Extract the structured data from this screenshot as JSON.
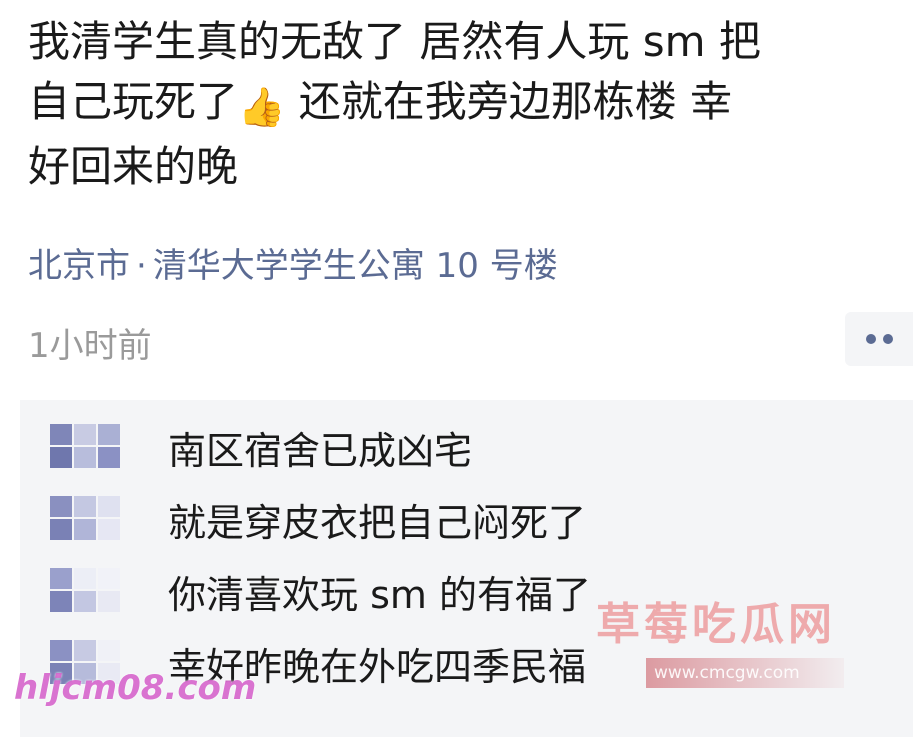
{
  "post": {
    "line1": "我清学生真的无敌了 居然有人玩 sm 把",
    "line2_a": "自己玩死了",
    "line2_emoji": "👍",
    "line2_b": " 还就在我旁边那栋楼 幸",
    "line3": "好回来的晚",
    "location_city": "北京市",
    "location_sep": "·",
    "location_place": "清华大学学生公寓 10 号楼",
    "time": "1小时前"
  },
  "more_icon": "more-dots-icon",
  "comments": [
    {
      "text": "南区宿舍已成凶宅",
      "avatar_colors": [
        "#7f86b8",
        "#c8cbe3",
        "#aab0d4",
        "#6f77ad",
        "#b8bddc",
        "#8b91c4"
      ]
    },
    {
      "text": "就是穿皮衣把自己闷死了",
      "avatar_colors": [
        "#8a90c0",
        "#c4c8e2",
        "#dfe1f0",
        "#7a81b5",
        "#b0b5d8",
        "#e6e7f3"
      ]
    },
    {
      "text": "你清喜欢玩 sm 的有福了",
      "avatar_colors": [
        "#9aa0cc",
        "#eceef6",
        "#f1f2f8",
        "#7d84b8",
        "#c3c7e2",
        "#e8e9f3"
      ]
    },
    {
      "text": "幸好昨晚在外吃四季民福",
      "avatar_colors": [
        "#8b91c3",
        "#c7cae3",
        "#f0f1f7",
        "#7b82b6",
        "#b6bbdb",
        "#e9eaf4"
      ]
    }
  ],
  "watermarks": {
    "site_name": "草莓吃瓜网",
    "site_url": "www.cmcgw.com",
    "left_mark": "hljcm08.com"
  },
  "colors": {
    "link": "#5b6b93",
    "muted": "#9a9a9a",
    "comment_bg": "#f4f5f7"
  }
}
